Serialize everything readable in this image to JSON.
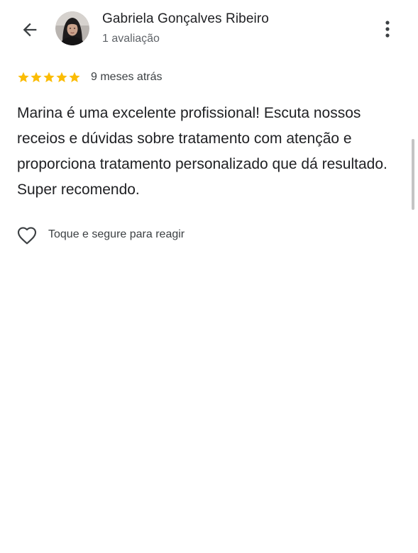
{
  "header": {
    "back_icon": "arrow-left-icon",
    "reviewer_name": "Gabriela Gonçalves Ribeiro",
    "review_count": "1 avaliação",
    "more_icon": "more-vert-icon"
  },
  "review": {
    "rating": 5,
    "rating_max": 5,
    "star_color": "#FBBC04",
    "date": "9 meses atrás",
    "text": "Marina é uma excelente profissional! Escuta nossos receios e dúvidas sobre tratamento com atenção e proporciona tratamento personalizado que dá resultado. Super recomendo."
  },
  "reaction": {
    "icon": "heart-outline-icon",
    "label": "Toque e segure para reagir"
  }
}
